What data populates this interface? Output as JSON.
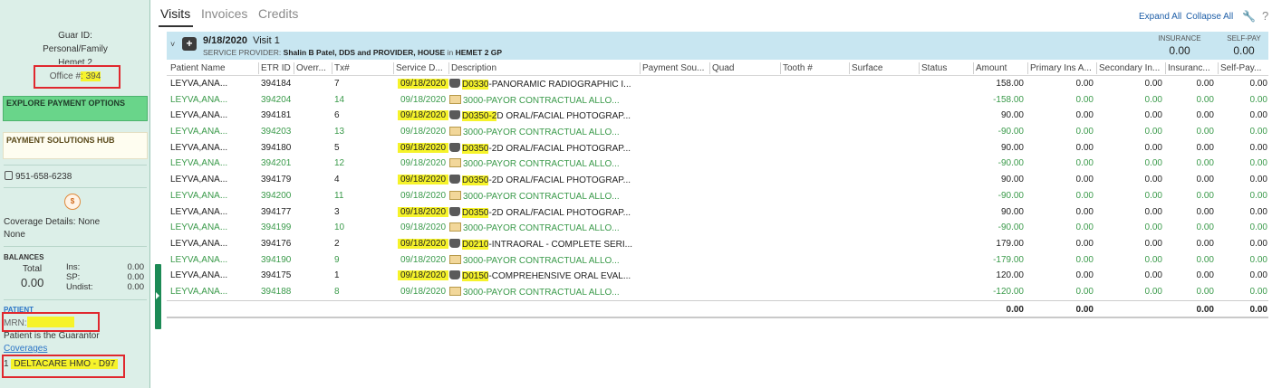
{
  "left_panel": {
    "guar_id_label": "Guar ID:",
    "personal_family": "Personal/Family",
    "location_partial": "Hemet 2",
    "office_label": "Office #",
    "office_value": ": 394",
    "explore_label": "EXPLORE PAYMENT OPTIONS",
    "payment_hub_label": "PAYMENT SOLUTIONS HUB",
    "phone": "951-658-6238",
    "coverage_details": "Coverage Details: None",
    "coverage_none": "None",
    "balances": {
      "heading": "BALANCES",
      "total_label": "Total",
      "total_value": "0.00",
      "ins_label": "Ins:",
      "ins_value": "0.00",
      "sp_label": "SP:",
      "sp_value": "0.00",
      "undist_label": "Undist:",
      "undist_value": "0.00"
    },
    "patient_heading": "PATIENT",
    "mrn_label": "MRN:",
    "guarantor_text": "Patient is the Guarantor",
    "coverages_link": "Coverages",
    "plan_index": "1",
    "plan_name": "DELTACARE HMO - D97"
  },
  "tabs": [
    {
      "label": "Visits",
      "active": true
    },
    {
      "label": "Invoices",
      "active": false
    },
    {
      "label": "Credits",
      "active": false
    }
  ],
  "toolbar": {
    "expand_all": "Expand All",
    "collapse_all": "Collapse All",
    "help": "?"
  },
  "visit": {
    "date": "9/18/2020",
    "title": "Visit 1",
    "provider_label": "SERVICE PROVIDER:",
    "provider_name": "Shalin B Patel, DDS and PROVIDER, HOUSE",
    "in_word": "in",
    "location": "HEMET 2 GP",
    "insurance_label": "INSURANCE",
    "insurance_value": "0.00",
    "selfpay_label": "SELF-PAY",
    "selfpay_value": "0.00"
  },
  "columns": [
    "Patient Name",
    "ETR ID",
    "Overr...",
    "Tx#",
    "Service D...",
    "Description",
    "Payment Sou...",
    "Quad",
    "Tooth #",
    "Surface",
    "Status",
    "Amount",
    "Primary Ins A...",
    "Secondary In...",
    "Insuranc...",
    "Self-Pay..."
  ],
  "rows": [
    {
      "type": "proc",
      "patient": "LEYVA,ANA...",
      "etr": "394184",
      "tx": "7",
      "date": "09/18/2020",
      "code": "D0330",
      "desc": "-PANORAMIC RADIOGRAPHIC I...",
      "amount": "158.00",
      "primary": "0.00",
      "secondary": "0.00",
      "insurance": "0.00",
      "selfpay": "0.00"
    },
    {
      "type": "adj",
      "patient": "LEYVA,ANA...",
      "etr": "394204",
      "tx": "14",
      "date": "09/18/2020",
      "code": "",
      "desc": "3000-PAYOR CONTRACTUAL ALLO...",
      "amount": "-158.00",
      "primary": "0.00",
      "secondary": "0.00",
      "insurance": "0.00",
      "selfpay": "0.00"
    },
    {
      "type": "proc",
      "patient": "LEYVA,ANA...",
      "etr": "394181",
      "tx": "6",
      "date": "09/18/2020",
      "code": "D0350-2",
      "desc": "D ORAL/FACIAL PHOTOGRAP...",
      "amount": "90.00",
      "primary": "0.00",
      "secondary": "0.00",
      "insurance": "0.00",
      "selfpay": "0.00"
    },
    {
      "type": "adj",
      "patient": "LEYVA,ANA...",
      "etr": "394203",
      "tx": "13",
      "date": "09/18/2020",
      "code": "",
      "desc": "3000-PAYOR CONTRACTUAL ALLO...",
      "amount": "-90.00",
      "primary": "0.00",
      "secondary": "0.00",
      "insurance": "0.00",
      "selfpay": "0.00"
    },
    {
      "type": "proc",
      "patient": "LEYVA,ANA...",
      "etr": "394180",
      "tx": "5",
      "date": "09/18/2020",
      "code": "D0350",
      "desc": "-2D ORAL/FACIAL PHOTOGRAP...",
      "amount": "90.00",
      "primary": "0.00",
      "secondary": "0.00",
      "insurance": "0.00",
      "selfpay": "0.00"
    },
    {
      "type": "adj",
      "patient": "LEYVA,ANA...",
      "etr": "394201",
      "tx": "12",
      "date": "09/18/2020",
      "code": "",
      "desc": "3000-PAYOR CONTRACTUAL ALLO...",
      "amount": "-90.00",
      "primary": "0.00",
      "secondary": "0.00",
      "insurance": "0.00",
      "selfpay": "0.00"
    },
    {
      "type": "proc",
      "patient": "LEYVA,ANA...",
      "etr": "394179",
      "tx": "4",
      "date": "09/18/2020",
      "code": "D0350",
      "desc": "-2D ORAL/FACIAL PHOTOGRAP...",
      "amount": "90.00",
      "primary": "0.00",
      "secondary": "0.00",
      "insurance": "0.00",
      "selfpay": "0.00"
    },
    {
      "type": "adj",
      "patient": "LEYVA,ANA...",
      "etr": "394200",
      "tx": "11",
      "date": "09/18/2020",
      "code": "",
      "desc": "3000-PAYOR CONTRACTUAL ALLO...",
      "amount": "-90.00",
      "primary": "0.00",
      "secondary": "0.00",
      "insurance": "0.00",
      "selfpay": "0.00"
    },
    {
      "type": "proc",
      "patient": "LEYVA,ANA...",
      "etr": "394177",
      "tx": "3",
      "date": "09/18/2020",
      "code": "D0350",
      "desc": "-2D ORAL/FACIAL PHOTOGRAP...",
      "amount": "90.00",
      "primary": "0.00",
      "secondary": "0.00",
      "insurance": "0.00",
      "selfpay": "0.00"
    },
    {
      "type": "adj",
      "patient": "LEYVA,ANA...",
      "etr": "394199",
      "tx": "10",
      "date": "09/18/2020",
      "code": "",
      "desc": "3000-PAYOR CONTRACTUAL ALLO...",
      "amount": "-90.00",
      "primary": "0.00",
      "secondary": "0.00",
      "insurance": "0.00",
      "selfpay": "0.00"
    },
    {
      "type": "proc",
      "patient": "LEYVA,ANA...",
      "etr": "394176",
      "tx": "2",
      "date": "09/18/2020",
      "code": "D0210",
      "desc": "-INTRAORAL - COMPLETE SERI...",
      "amount": "179.00",
      "primary": "0.00",
      "secondary": "0.00",
      "insurance": "0.00",
      "selfpay": "0.00"
    },
    {
      "type": "adj",
      "patient": "LEYVA,ANA...",
      "etr": "394190",
      "tx": "9",
      "date": "09/18/2020",
      "code": "",
      "desc": "3000-PAYOR CONTRACTUAL ALLO...",
      "amount": "-179.00",
      "primary": "0.00",
      "secondary": "0.00",
      "insurance": "0.00",
      "selfpay": "0.00"
    },
    {
      "type": "proc",
      "patient": "LEYVA,ANA...",
      "etr": "394175",
      "tx": "1",
      "date": "09/18/2020",
      "code": "D0150",
      "desc": "-COMPREHENSIVE ORAL EVAL...",
      "amount": "120.00",
      "primary": "0.00",
      "secondary": "0.00",
      "insurance": "0.00",
      "selfpay": "0.00"
    },
    {
      "type": "adj",
      "patient": "LEYVA,ANA...",
      "etr": "394188",
      "tx": "8",
      "date": "09/18/2020",
      "code": "",
      "desc": "3000-PAYOR CONTRACTUAL ALLO...",
      "amount": "-120.00",
      "primary": "0.00",
      "secondary": "0.00",
      "insurance": "0.00",
      "selfpay": "0.00"
    }
  ],
  "totals": {
    "amount": "0.00",
    "primary": "0.00",
    "insurance": "0.00",
    "selfpay": "0.00"
  },
  "colors": {
    "panel_bg": "#dcefe8",
    "accent_green": "#1c8a55",
    "highlight": "#f6f32a",
    "annotation_red": "#e0282e",
    "visit_header": "#c8e6f1",
    "adjustment_text": "#3a9a4a"
  },
  "icons": {
    "phone": "phone-icon",
    "coin": "payment-coin-icon",
    "visit": "medical-bag-icon",
    "wrench": "wrench-icon",
    "procedure": "tooth-icon",
    "adjustment": "adjustment-ticket-icon"
  }
}
